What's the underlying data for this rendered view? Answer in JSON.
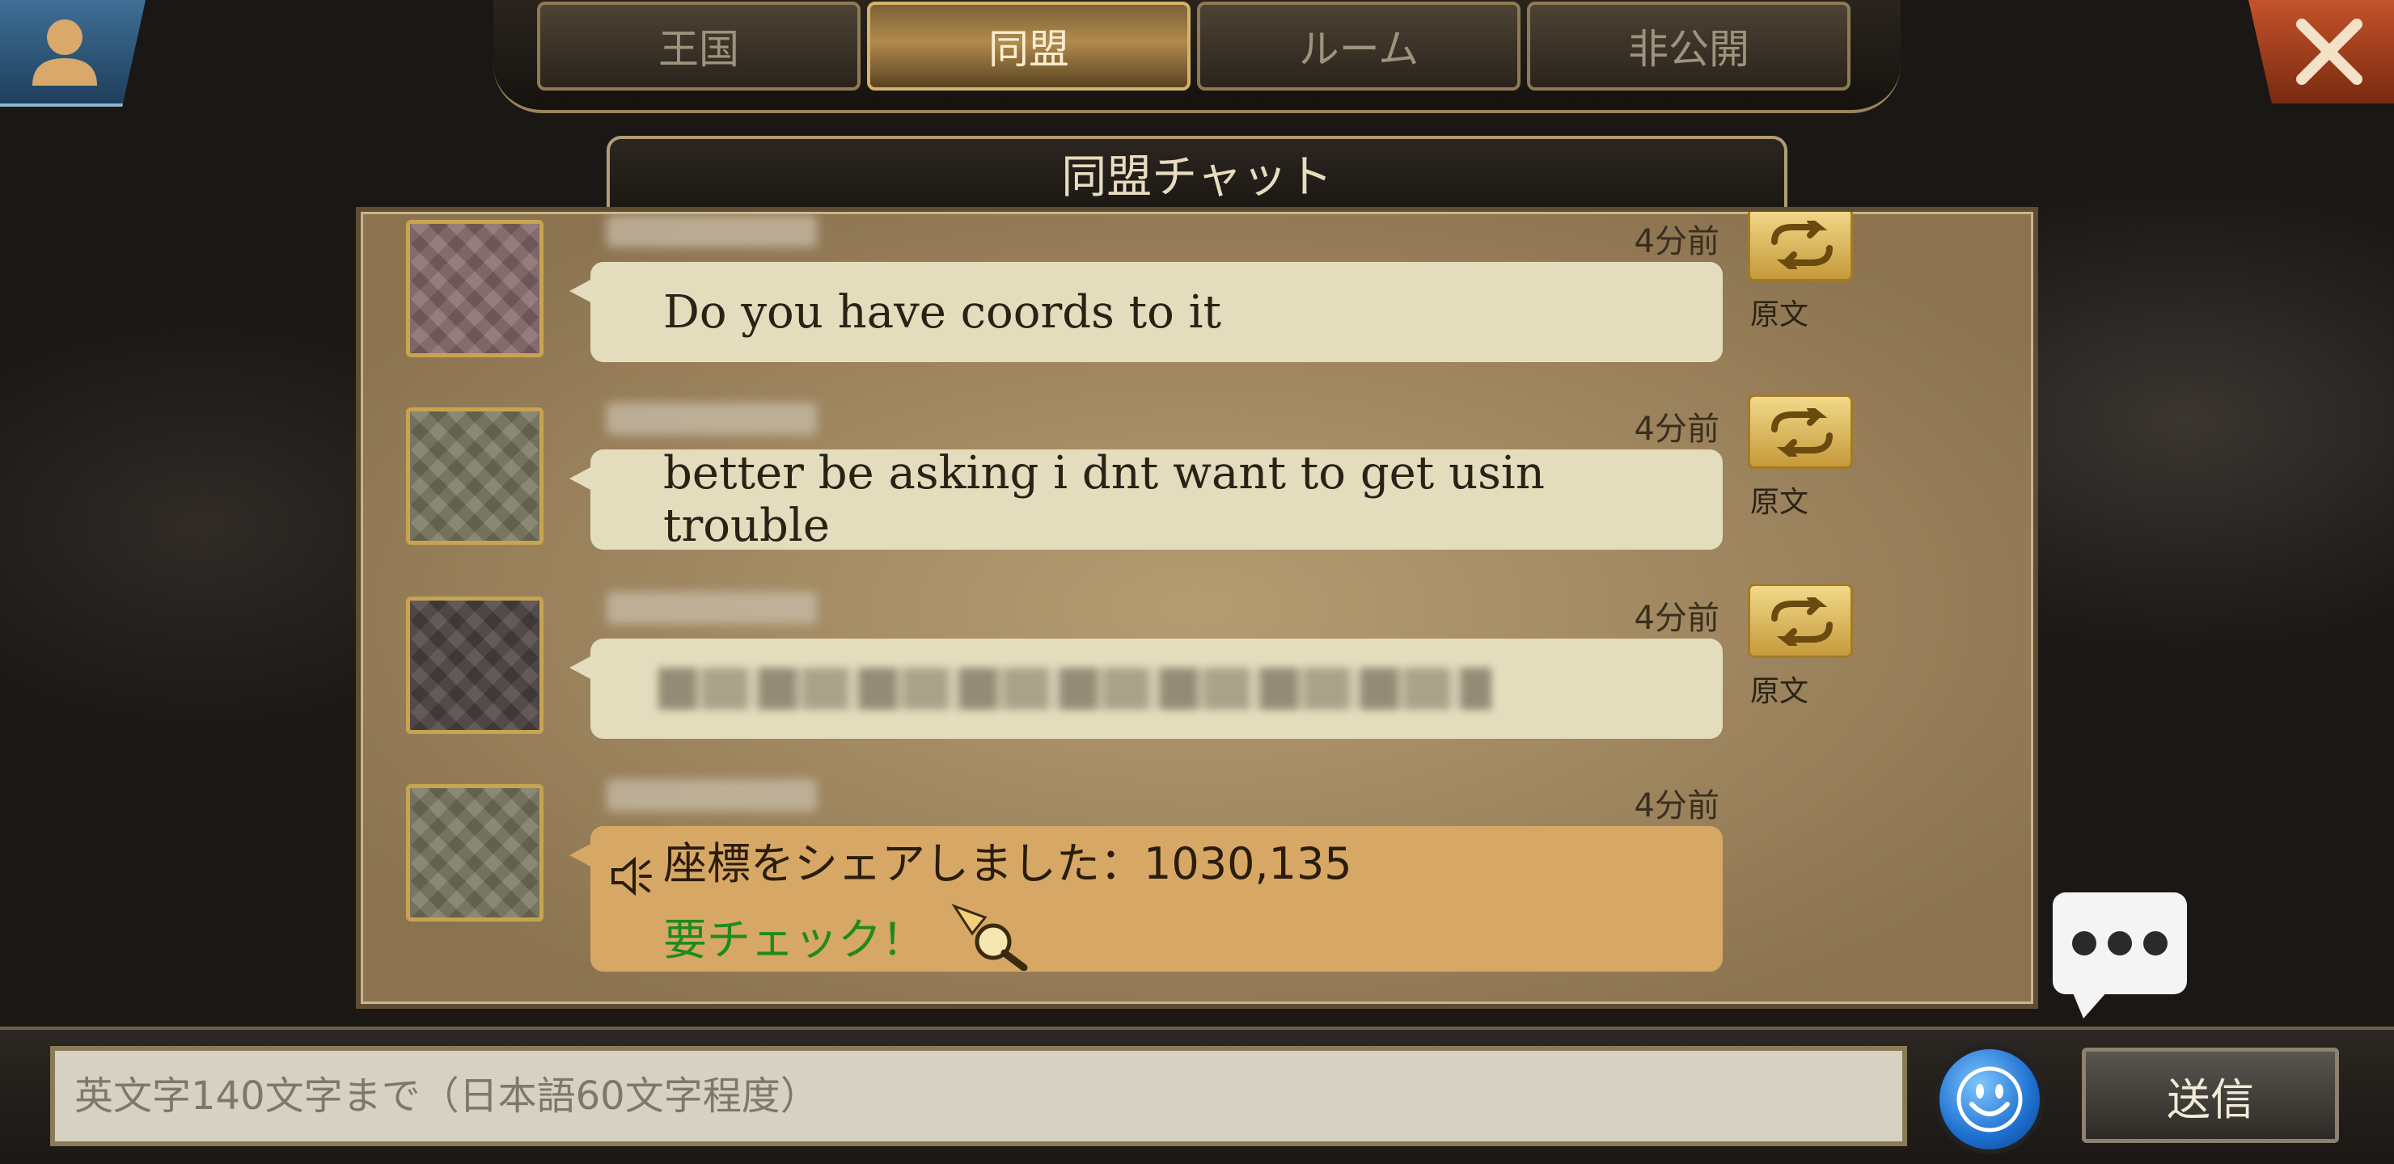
{
  "tabs": [
    {
      "label": "王国",
      "active": false
    },
    {
      "label": "同盟",
      "active": true
    },
    {
      "label": "ルーム",
      "active": false
    },
    {
      "label": "非公開",
      "active": false
    }
  ],
  "chat": {
    "title": "同盟チャット",
    "messages": [
      {
        "time": "4分前",
        "text": "Do you have coords to it",
        "translate_label": "原文"
      },
      {
        "time": "4分前",
        "text": "better be asking i dnt want to get usin trouble",
        "translate_label": "原文"
      },
      {
        "time": "4分前",
        "text": "",
        "translate_label": "原文"
      },
      {
        "time": "4分前",
        "coords_text": "座標をシェアしました：1030,135",
        "check_text": "要チェック！"
      }
    ]
  },
  "input": {
    "placeholder": "英文字140文字まで（日本語60文字程度）"
  },
  "send_label": "送信",
  "colors": {
    "accent_gold": "#c8a450",
    "bubble": "#e3ddbd",
    "coords_bubble": "#d7a865",
    "check_green": "#1f8a1f"
  }
}
